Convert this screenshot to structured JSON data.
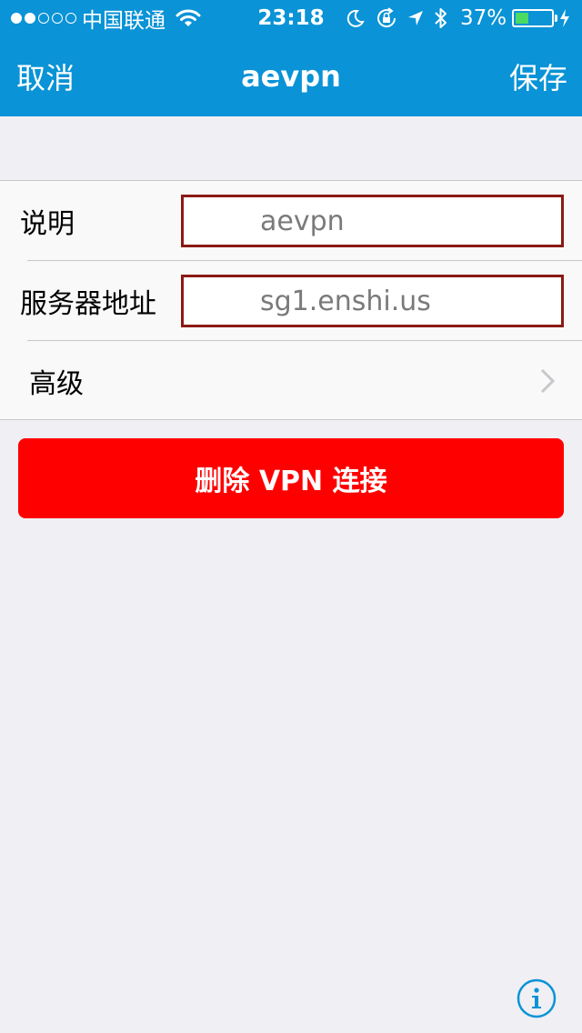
{
  "status_bar": {
    "carrier": "中国联通",
    "time": "23:18",
    "battery_percent": "37%",
    "battery_level": 0.37,
    "signal_dots_filled": 2,
    "signal_dots_total": 5
  },
  "nav": {
    "cancel_label": "取消",
    "title": "aevpn",
    "save_label": "保存"
  },
  "form": {
    "description_label": "说明",
    "description_value": "aevpn",
    "server_label": "服务器地址",
    "server_value": "sg1.enshi.us",
    "advanced_label": "高级"
  },
  "delete_button_label": "删除 VPN 连接",
  "colors": {
    "header_blue": "#0a93d6",
    "delete_red": "#ff0000",
    "field_border": "#8a1a14",
    "battery_green": "#4cd964",
    "background": "#efeff4",
    "info_icon_blue": "#0a93d6"
  }
}
